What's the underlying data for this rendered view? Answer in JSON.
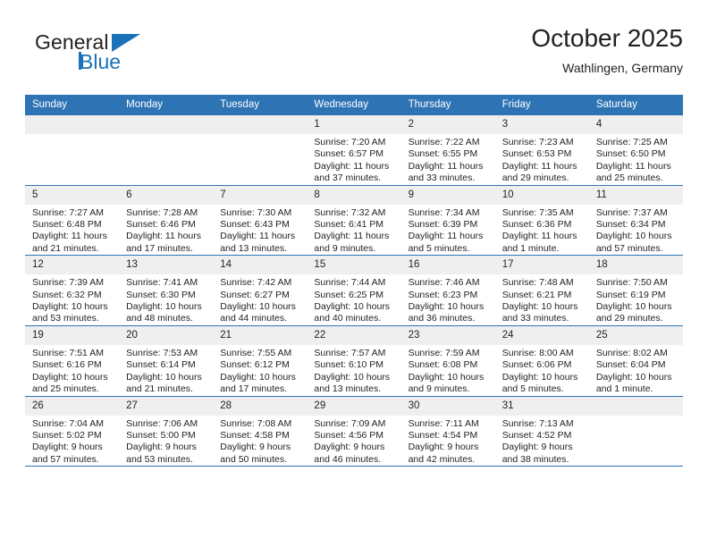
{
  "brand": {
    "line1": "General",
    "line2": "Blue",
    "accent_color": "#1b72b8"
  },
  "header": {
    "title": "October 2025",
    "location": "Wathlingen, Germany",
    "header_bg_color": "#2e74b5"
  },
  "weekday_headers": [
    "Sunday",
    "Monday",
    "Tuesday",
    "Wednesday",
    "Thursday",
    "Friday",
    "Saturday"
  ],
  "labels": {
    "sunrise_prefix": "Sunrise:",
    "sunset_prefix": "Sunset:",
    "daylight_prefix": "Daylight:"
  },
  "weeks": [
    [
      {
        "day": "",
        "empty": true
      },
      {
        "day": "",
        "empty": true
      },
      {
        "day": "",
        "empty": true
      },
      {
        "day": "1",
        "sunrise": "Sunrise: 7:20 AM",
        "sunset": "Sunset: 6:57 PM",
        "daylight": "Daylight: 11 hours and 37 minutes."
      },
      {
        "day": "2",
        "sunrise": "Sunrise: 7:22 AM",
        "sunset": "Sunset: 6:55 PM",
        "daylight": "Daylight: 11 hours and 33 minutes."
      },
      {
        "day": "3",
        "sunrise": "Sunrise: 7:23 AM",
        "sunset": "Sunset: 6:53 PM",
        "daylight": "Daylight: 11 hours and 29 minutes."
      },
      {
        "day": "4",
        "sunrise": "Sunrise: 7:25 AM",
        "sunset": "Sunset: 6:50 PM",
        "daylight": "Daylight: 11 hours and 25 minutes."
      }
    ],
    [
      {
        "day": "5",
        "sunrise": "Sunrise: 7:27 AM",
        "sunset": "Sunset: 6:48 PM",
        "daylight": "Daylight: 11 hours and 21 minutes."
      },
      {
        "day": "6",
        "sunrise": "Sunrise: 7:28 AM",
        "sunset": "Sunset: 6:46 PM",
        "daylight": "Daylight: 11 hours and 17 minutes."
      },
      {
        "day": "7",
        "sunrise": "Sunrise: 7:30 AM",
        "sunset": "Sunset: 6:43 PM",
        "daylight": "Daylight: 11 hours and 13 minutes."
      },
      {
        "day": "8",
        "sunrise": "Sunrise: 7:32 AM",
        "sunset": "Sunset: 6:41 PM",
        "daylight": "Daylight: 11 hours and 9 minutes."
      },
      {
        "day": "9",
        "sunrise": "Sunrise: 7:34 AM",
        "sunset": "Sunset: 6:39 PM",
        "daylight": "Daylight: 11 hours and 5 minutes."
      },
      {
        "day": "10",
        "sunrise": "Sunrise: 7:35 AM",
        "sunset": "Sunset: 6:36 PM",
        "daylight": "Daylight: 11 hours and 1 minute."
      },
      {
        "day": "11",
        "sunrise": "Sunrise: 7:37 AM",
        "sunset": "Sunset: 6:34 PM",
        "daylight": "Daylight: 10 hours and 57 minutes."
      }
    ],
    [
      {
        "day": "12",
        "sunrise": "Sunrise: 7:39 AM",
        "sunset": "Sunset: 6:32 PM",
        "daylight": "Daylight: 10 hours and 53 minutes."
      },
      {
        "day": "13",
        "sunrise": "Sunrise: 7:41 AM",
        "sunset": "Sunset: 6:30 PM",
        "daylight": "Daylight: 10 hours and 48 minutes."
      },
      {
        "day": "14",
        "sunrise": "Sunrise: 7:42 AM",
        "sunset": "Sunset: 6:27 PM",
        "daylight": "Daylight: 10 hours and 44 minutes."
      },
      {
        "day": "15",
        "sunrise": "Sunrise: 7:44 AM",
        "sunset": "Sunset: 6:25 PM",
        "daylight": "Daylight: 10 hours and 40 minutes."
      },
      {
        "day": "16",
        "sunrise": "Sunrise: 7:46 AM",
        "sunset": "Sunset: 6:23 PM",
        "daylight": "Daylight: 10 hours and 36 minutes."
      },
      {
        "day": "17",
        "sunrise": "Sunrise: 7:48 AM",
        "sunset": "Sunset: 6:21 PM",
        "daylight": "Daylight: 10 hours and 33 minutes."
      },
      {
        "day": "18",
        "sunrise": "Sunrise: 7:50 AM",
        "sunset": "Sunset: 6:19 PM",
        "daylight": "Daylight: 10 hours and 29 minutes."
      }
    ],
    [
      {
        "day": "19",
        "sunrise": "Sunrise: 7:51 AM",
        "sunset": "Sunset: 6:16 PM",
        "daylight": "Daylight: 10 hours and 25 minutes."
      },
      {
        "day": "20",
        "sunrise": "Sunrise: 7:53 AM",
        "sunset": "Sunset: 6:14 PM",
        "daylight": "Daylight: 10 hours and 21 minutes."
      },
      {
        "day": "21",
        "sunrise": "Sunrise: 7:55 AM",
        "sunset": "Sunset: 6:12 PM",
        "daylight": "Daylight: 10 hours and 17 minutes."
      },
      {
        "day": "22",
        "sunrise": "Sunrise: 7:57 AM",
        "sunset": "Sunset: 6:10 PM",
        "daylight": "Daylight: 10 hours and 13 minutes."
      },
      {
        "day": "23",
        "sunrise": "Sunrise: 7:59 AM",
        "sunset": "Sunset: 6:08 PM",
        "daylight": "Daylight: 10 hours and 9 minutes."
      },
      {
        "day": "24",
        "sunrise": "Sunrise: 8:00 AM",
        "sunset": "Sunset: 6:06 PM",
        "daylight": "Daylight: 10 hours and 5 minutes."
      },
      {
        "day": "25",
        "sunrise": "Sunrise: 8:02 AM",
        "sunset": "Sunset: 6:04 PM",
        "daylight": "Daylight: 10 hours and 1 minute."
      }
    ],
    [
      {
        "day": "26",
        "sunrise": "Sunrise: 7:04 AM",
        "sunset": "Sunset: 5:02 PM",
        "daylight": "Daylight: 9 hours and 57 minutes."
      },
      {
        "day": "27",
        "sunrise": "Sunrise: 7:06 AM",
        "sunset": "Sunset: 5:00 PM",
        "daylight": "Daylight: 9 hours and 53 minutes."
      },
      {
        "day": "28",
        "sunrise": "Sunrise: 7:08 AM",
        "sunset": "Sunset: 4:58 PM",
        "daylight": "Daylight: 9 hours and 50 minutes."
      },
      {
        "day": "29",
        "sunrise": "Sunrise: 7:09 AM",
        "sunset": "Sunset: 4:56 PM",
        "daylight": "Daylight: 9 hours and 46 minutes."
      },
      {
        "day": "30",
        "sunrise": "Sunrise: 7:11 AM",
        "sunset": "Sunset: 4:54 PM",
        "daylight": "Daylight: 9 hours and 42 minutes."
      },
      {
        "day": "31",
        "sunrise": "Sunrise: 7:13 AM",
        "sunset": "Sunset: 4:52 PM",
        "daylight": "Daylight: 9 hours and 38 minutes."
      },
      {
        "day": "",
        "empty": true
      }
    ]
  ]
}
